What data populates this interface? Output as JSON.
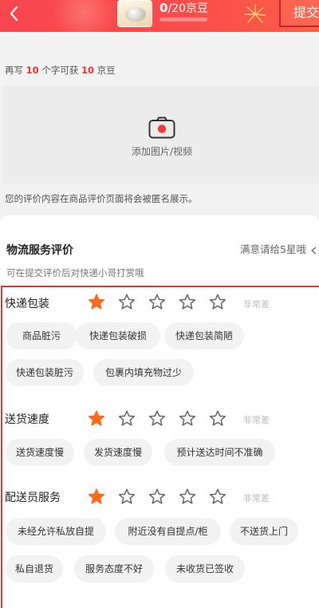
{
  "header": {
    "bean_count": "0",
    "bean_total": "/20京豆",
    "bean_progress": 0,
    "submit_label": "提交",
    "back_icon": "chevron-left-icon"
  },
  "review": {
    "tip_prefix": "再写",
    "tip_chars": "10",
    "tip_middle": "个字可获",
    "tip_beans": "10",
    "tip_suffix": "京豆",
    "upload_label": "添加图片/视频",
    "anon_notice": "您的评价内容在商品评价页面将会被匿名展示。"
  },
  "logistics": {
    "title": "物流服务评价",
    "hint": "满意请给5星哦",
    "subtip": "可在提交评价后对快递小哥打赏哦",
    "accent_color": "#ff6a1a",
    "categories": [
      {
        "label": "快递包装",
        "rating": 1,
        "rating_text": "非常差",
        "tags": [
          "商品脏污",
          "快递包装破损",
          "快递包装简陋",
          "快递包装脏污",
          "包裹内填充物过少"
        ]
      },
      {
        "label": "送货速度",
        "rating": 1,
        "rating_text": "非常差",
        "tags": [
          "送货速度慢",
          "发货速度慢",
          "预计送达时间不准确"
        ]
      },
      {
        "label": "配送员服务",
        "rating": 1,
        "rating_text": "非常差",
        "tags": [
          "未经允许私放自提",
          "附近没有自提点/柜",
          "不送货上门",
          "私自退货",
          "服务态度不好",
          "未收货已签收"
        ]
      }
    ]
  }
}
